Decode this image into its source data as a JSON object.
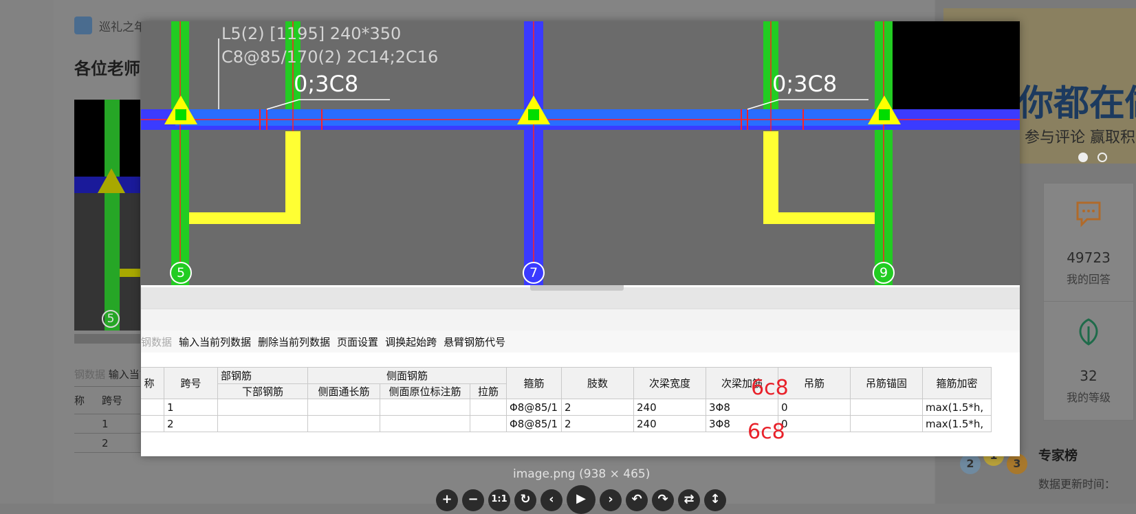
{
  "post": {
    "author": "巡礼之年",
    "title": "各位老师"
  },
  "thumbnail": {
    "node_label": "5",
    "menu_faded": "钢数据",
    "menu_item": "输入当前",
    "col_name": "称",
    "col_span": "跨号",
    "rows": [
      "1",
      "2"
    ]
  },
  "sidebar": {
    "banner_main": "你都在做",
    "banner_sub": "参与评论 赢取积",
    "answers_count": "49723",
    "answers_label": "我的回答",
    "level_value": "32",
    "level_label": "我的等级",
    "expert_title": "专家榜",
    "expert_subtitle": "数据更新时间：",
    "medals": [
      "2",
      "1",
      "3"
    ]
  },
  "cad": {
    "beam_label_line1": "L5(2) [1195] 240*350",
    "beam_label_line2": "C8@85/170(2) 2C14;2C16",
    "left_annotation": "0;3C8",
    "right_annotation": "0;3C8",
    "nodes": [
      "5",
      "7",
      "9"
    ],
    "colors": {
      "background": "#6b6b6b",
      "beam": "#3b3bff",
      "column_green": "#22cc22",
      "column_blue": "#3a3aff",
      "yellow": "#ffff33",
      "red_axis": "#ff2222",
      "support_triangle": "#ffff00",
      "support_square": "#00dd00"
    }
  },
  "toolbar": {
    "disabled_item": "钢数据",
    "items": [
      "输入当前列数据",
      "删除当前列数据",
      "页面设置",
      "调换起始跨",
      "悬臂钢筋代号"
    ]
  },
  "grid": {
    "group_headers": {
      "bottom_rebar": "部钢筋",
      "side_rebar": "侧面钢筋"
    },
    "headers": {
      "name": "称",
      "span": "跨号",
      "bottom_bar": "下部钢筋",
      "side_through": "侧面通长筋",
      "side_in_place": "侧面原位标注筋",
      "tie_bar": "拉筋",
      "stirrup": "箍筋",
      "legs": "肢数",
      "sec_beam_width": "次梁宽度",
      "sec_beam_add": "次梁加筋",
      "hanger": "吊筋",
      "hanger_anchor": "吊筋锚固",
      "stirrup_dense": "箍筋加密"
    },
    "rows": [
      {
        "span": "1",
        "stirrup": "Φ8@85/1",
        "legs": "2",
        "width": "240",
        "sec_add": "3Φ8",
        "hanger": "0",
        "dense": "max(1.5*h,"
      },
      {
        "span": "2",
        "stirrup": "Φ8@85/1",
        "legs": "2",
        "width": "240",
        "sec_add": "3Φ8",
        "hanger": "0",
        "dense": "max(1.5*h,"
      }
    ]
  },
  "annotations": {
    "red_1": "6c8",
    "red_2": "6c8"
  },
  "viewer": {
    "caption": "image.png (938 × 465)",
    "controls": [
      "+",
      "−",
      "1:1",
      "↻",
      "‹",
      "▶",
      "›",
      "↶",
      "↷",
      "⇄",
      "↕"
    ]
  }
}
